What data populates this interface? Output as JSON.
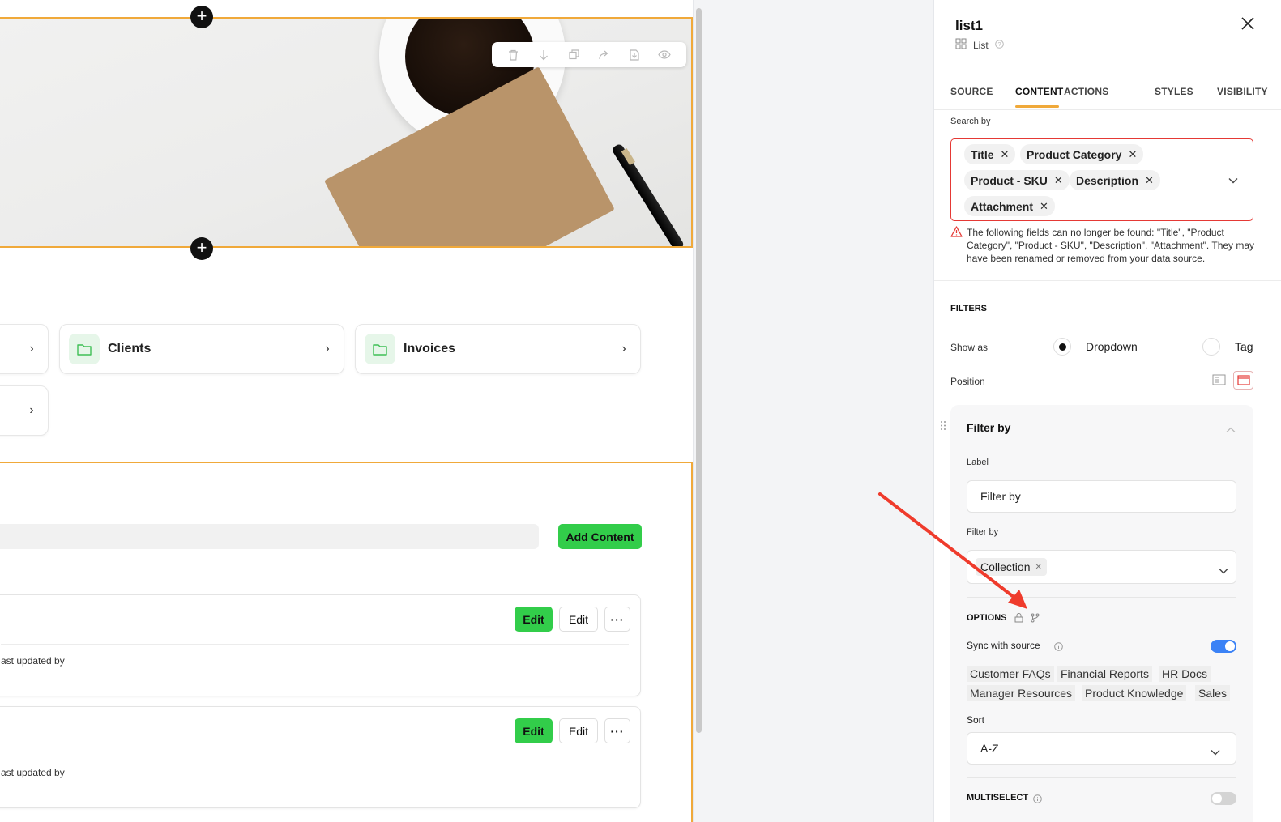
{
  "canvas": {
    "hero_toolbar_icons": [
      "trash-icon",
      "arrow-down-icon",
      "copy-icon",
      "redo-icon",
      "export-icon",
      "eye-icon"
    ],
    "cards": [
      {
        "label": "Clients"
      },
      {
        "label": "Invoices"
      }
    ],
    "add_content_label": "Add Content",
    "rows": [
      {
        "edit_primary": "Edit",
        "edit_secondary": "Edit",
        "more": "···",
        "meta": "ast updated by"
      },
      {
        "edit_primary": "Edit",
        "edit_secondary": "Edit",
        "more": "···",
        "meta": "ast updated by"
      }
    ],
    "plus": "+"
  },
  "panel": {
    "title": "list1",
    "subtitle": "List",
    "tabs": [
      "SOURCE",
      "CONTENT",
      "ACTIONS",
      "STYLES",
      "VISIBILITY"
    ],
    "active_tab": "CONTENT",
    "search_by_label": "Search by",
    "search_by_chips": [
      "Title",
      "Product Category",
      "Product - SKU",
      "Description",
      "Attachment"
    ],
    "search_error": "The following fields can no longer be found: \"Title\", \"Product Category\", \"Product - SKU\", \"Description\", \"Attachment\". They may have been renamed or removed from your data source.",
    "filters_heading": "FILTERS",
    "show_as_label": "Show as",
    "show_as_options": [
      "Dropdown",
      "Tag"
    ],
    "show_as_selected": "Dropdown",
    "position_label": "Position",
    "filter_by_title": "Filter by",
    "label_label": "Label",
    "label_value": "Filter by",
    "filter_by_label": "Filter by",
    "filter_by_chip": "Collection",
    "options_heading": "OPTIONS",
    "sync_label": "Sync with source",
    "sync_on": true,
    "option_tags": [
      "Customer FAQs",
      "Financial Reports",
      "HR Docs",
      "Manager Resources",
      "Product Knowledge",
      "Sales"
    ],
    "sort_label": "Sort",
    "sort_value": "A-Z",
    "multiselect_label": "MULTISELECT",
    "multiselect_on": false
  },
  "colors": {
    "accent_orange": "#f0a93a",
    "green": "#32cd4a",
    "error_red": "#e53935",
    "toggle_blue": "#3b82f6",
    "annotation_arrow": "#ef3b2c"
  }
}
